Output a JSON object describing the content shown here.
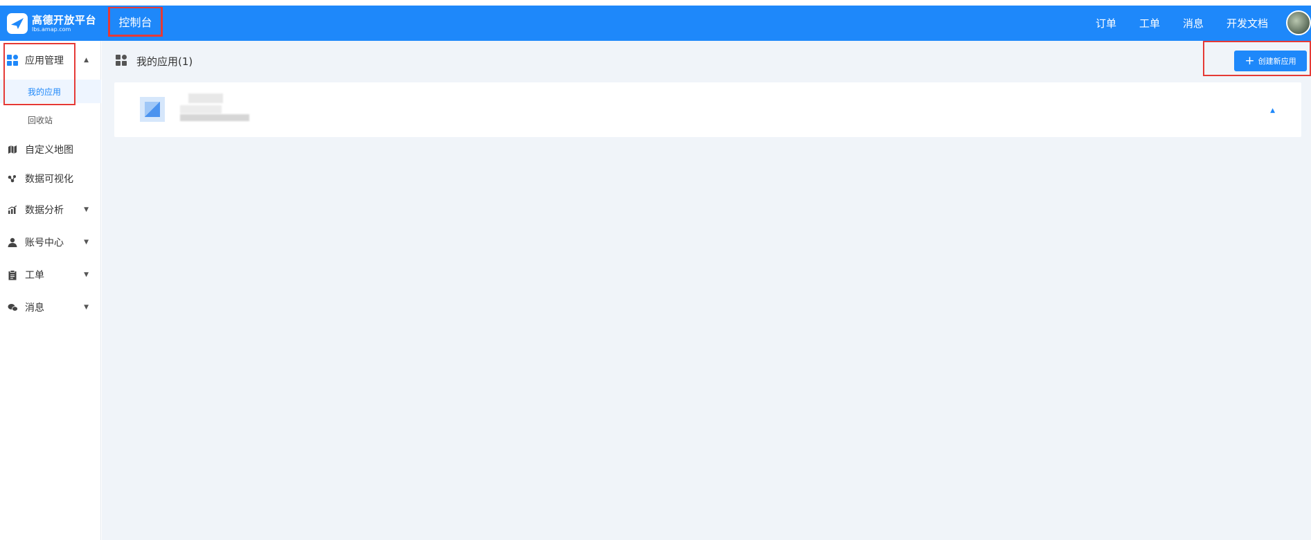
{
  "header": {
    "logo_cn": "高德开放平台",
    "logo_en": "lbs.amap.com",
    "console": "控制台",
    "nav": [
      "订单",
      "工单",
      "消息",
      "开发文档"
    ]
  },
  "sidebar": {
    "app_mgmt": "应用管理",
    "sub": [
      "我的应用",
      "回收站"
    ],
    "items": [
      "自定义地图",
      "数据可视化",
      "数据分析",
      "账号中心",
      "工单",
      "消息"
    ]
  },
  "main": {
    "title": "我的应用(1)",
    "create_button": "创建新应用"
  },
  "colors": {
    "accent": "#1e88fa",
    "highlight": "#e53935",
    "background": "#f0f4f9"
  }
}
